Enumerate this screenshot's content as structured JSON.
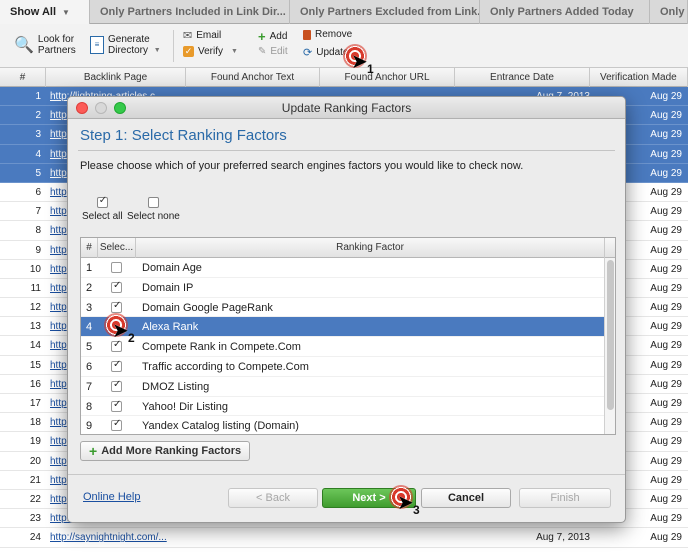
{
  "tabs": [
    {
      "label": "Show All",
      "active": true
    },
    {
      "label": "Only Partners Included in Link Dir..."
    },
    {
      "label": "Only Partners Excluded from Link..."
    },
    {
      "label": "Only Partners Added Today"
    },
    {
      "label": "Only"
    }
  ],
  "toolbar": {
    "look_line1": "Look for",
    "look_line2": "Partners",
    "gen_line1": "Generate",
    "gen_line2": "Directory",
    "email": "Email",
    "verify": "Verify",
    "add": "Add",
    "edit": "Edit",
    "remove": "Remove",
    "update": "Update"
  },
  "table": {
    "headers": [
      "#",
      "Backlink Page",
      "Found Anchor Text",
      "Found Anchor URL",
      "Entrance Date",
      "Verification Made"
    ],
    "rows": [
      {
        "n": "1",
        "link": "http://lightning-articles.c...",
        "date": "Aug 7, 2013",
        "vdate": "Aug 29"
      },
      {
        "n": "2",
        "link": "http",
        "date": "",
        "vdate": "Aug 29"
      },
      {
        "n": "3",
        "link": "http",
        "date": "",
        "vdate": "Aug 29"
      },
      {
        "n": "4",
        "link": "http",
        "date": "",
        "vdate": "Aug 29"
      },
      {
        "n": "5",
        "link": "http",
        "date": "",
        "vdate": "Aug 29"
      },
      {
        "n": "6",
        "link": "http",
        "date": "",
        "vdate": "Aug 29"
      },
      {
        "n": "7",
        "link": "http",
        "date": "",
        "vdate": "Aug 29"
      },
      {
        "n": "8",
        "link": "http",
        "date": "",
        "vdate": "Aug 29"
      },
      {
        "n": "9",
        "link": "http",
        "date": "",
        "vdate": "Aug 29"
      },
      {
        "n": "10",
        "link": "http",
        "date": "",
        "vdate": "Aug 29"
      },
      {
        "n": "11",
        "link": "http",
        "date": "",
        "vdate": "Aug 29"
      },
      {
        "n": "12",
        "link": "http",
        "date": "",
        "vdate": "Aug 29"
      },
      {
        "n": "13",
        "link": "http",
        "date": "",
        "vdate": "Aug 29"
      },
      {
        "n": "14",
        "link": "http",
        "date": "",
        "vdate": "Aug 29"
      },
      {
        "n": "15",
        "link": "http",
        "date": "",
        "vdate": "Aug 29"
      },
      {
        "n": "16",
        "link": "http",
        "date": "",
        "vdate": "Aug 29"
      },
      {
        "n": "17",
        "link": "http",
        "date": "",
        "vdate": "Aug 29"
      },
      {
        "n": "18",
        "link": "http",
        "date": "",
        "vdate": "Aug 29"
      },
      {
        "n": "19",
        "link": "http",
        "date": "",
        "vdate": "Aug 29"
      },
      {
        "n": "20",
        "link": "http",
        "date": "",
        "vdate": "Aug 29"
      },
      {
        "n": "21",
        "link": "http",
        "date": "",
        "vdate": "Aug 29"
      },
      {
        "n": "22",
        "link": "http",
        "date": "",
        "vdate": "Aug 29"
      },
      {
        "n": "23",
        "link": "http://www.seo.com/",
        "date": "Aug 7, 2013",
        "vdate": "Aug 29"
      },
      {
        "n": "24",
        "link": "http://saynightnight.com/...",
        "date": "Aug 7, 2013",
        "vdate": "Aug 29"
      }
    ]
  },
  "dialog": {
    "window_title": "Update Ranking Factors",
    "step_title": "Step 1: Select Ranking Factors",
    "instruction": "Please choose which of your preferred search engines factors you would like to check now.",
    "select_all": "Select all",
    "select_none": "Select none",
    "grid_headers": {
      "num": "#",
      "select": "Selec...",
      "factor": "Ranking Factor"
    },
    "factors": [
      {
        "n": "1",
        "label": "Domain Age",
        "checked": false
      },
      {
        "n": "2",
        "label": "Domain IP",
        "checked": true
      },
      {
        "n": "3",
        "label": "Domain Google PageRank",
        "checked": true
      },
      {
        "n": "4",
        "label": "Alexa Rank",
        "checked": true
      },
      {
        "n": "5",
        "label": "Compete Rank in Compete.Com",
        "checked": true
      },
      {
        "n": "6",
        "label": "Traffic according to Compete.Com",
        "checked": true
      },
      {
        "n": "7",
        "label": "DMOZ Listing",
        "checked": true
      },
      {
        "n": "8",
        "label": "Yahoo! Dir Listing",
        "checked": true
      },
      {
        "n": "9",
        "label": "Yandex Catalog listing (Domain)",
        "checked": true
      }
    ],
    "add_more": "Add More Ranking Factors",
    "online_help": "Online Help",
    "back": "< Back",
    "next": "Next >",
    "cancel": "Cancel",
    "finish": "Finish"
  },
  "markers": [
    "1",
    "2",
    "3"
  ],
  "colors": {
    "selection": "#4a7abf",
    "accent": "#2a6aa8",
    "next_button": "#3f9c2e",
    "marker": "#d83a2c"
  }
}
